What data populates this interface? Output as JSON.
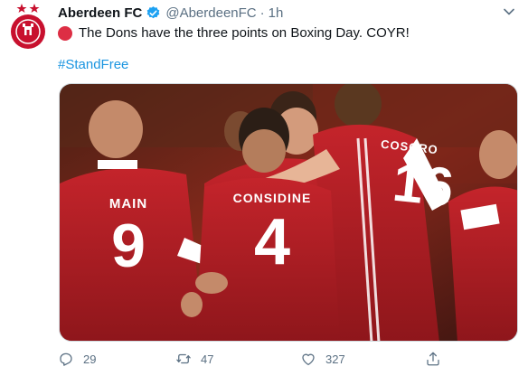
{
  "tweet": {
    "author_name": "Aberdeen FC",
    "handle": "@AberdeenFC",
    "separator": "·",
    "time": "1h",
    "text": "The Dons have the three points on Boxing Day. COYR!",
    "hashtag": "#StandFree",
    "emoji_icon": "red-circle-icon",
    "verified_icon": "verified-badge-icon"
  },
  "media": {
    "description_icon": "team-celebration-photo",
    "players": [
      {
        "name": "MAIN",
        "number": "9"
      },
      {
        "name": "CONSIDINE",
        "number": "4"
      },
      {
        "name": "COSGRO",
        "number": "16"
      }
    ]
  },
  "actions": {
    "reply_count": "29",
    "retweet_count": "47",
    "like_count": "327"
  },
  "colors": {
    "brand_red": "#c8102e",
    "link_blue": "#1b95e0",
    "verified_blue": "#1da1f2",
    "muted_text": "#5b7083"
  }
}
